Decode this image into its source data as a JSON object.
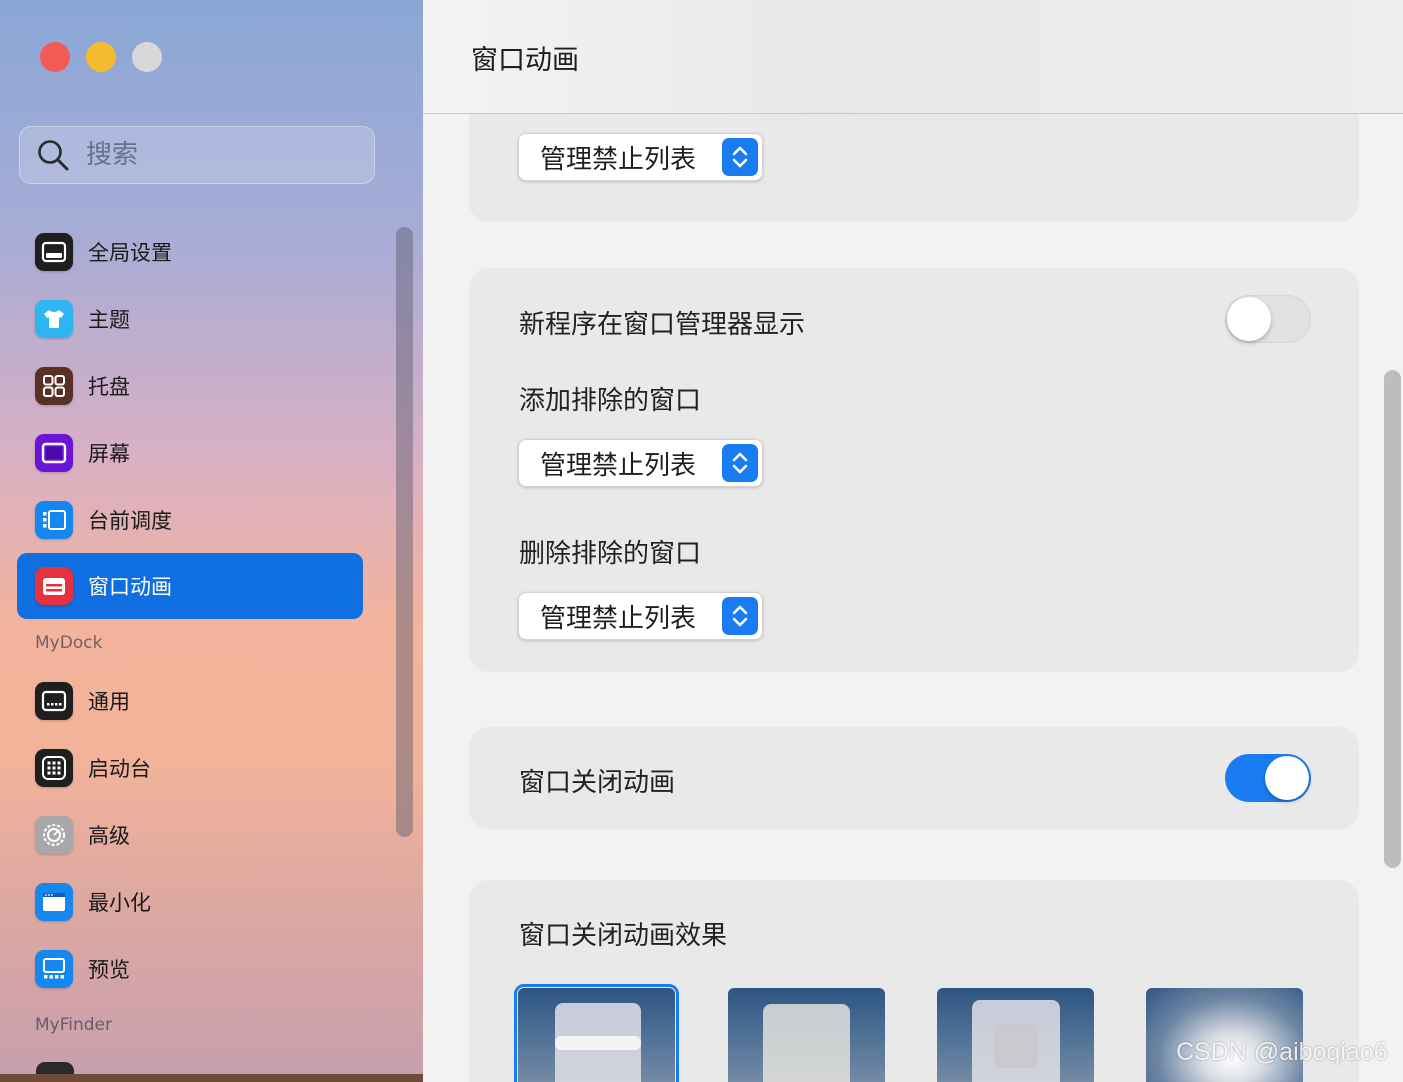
{
  "search": {
    "placeholder": "搜索"
  },
  "sidebar": {
    "items": [
      {
        "label": "全局设置",
        "icon": "window-icon"
      },
      {
        "label": "主题",
        "icon": "tshirt-icon"
      },
      {
        "label": "托盘",
        "icon": "grid-icon"
      },
      {
        "label": "屏幕",
        "icon": "screen-icon"
      },
      {
        "label": "台前调度",
        "icon": "stage-manager-icon"
      },
      {
        "label": "窗口动画",
        "icon": "window-animation-icon",
        "active": true
      }
    ],
    "mydock_header": "MyDock",
    "mydock_items": [
      {
        "label": "通用",
        "icon": "dock-icon"
      },
      {
        "label": "启动台",
        "icon": "launchpad-icon"
      },
      {
        "label": "高级",
        "icon": "gear-icon"
      },
      {
        "label": "最小化",
        "icon": "minimize-icon"
      },
      {
        "label": "预览",
        "icon": "preview-icon"
      }
    ],
    "myfinder_header": "MyFinder"
  },
  "main": {
    "title": "窗口动画",
    "popup_label": "管理禁止列表",
    "show_new_apps_label": "新程序在窗口管理器显示",
    "show_new_apps_on": false,
    "add_excluded_label": "添加排除的窗口",
    "remove_excluded_label": "删除排除的窗口",
    "close_animation_label": "窗口关闭动画",
    "close_animation_on": true,
    "close_effect_label": "窗口关闭动画效果"
  },
  "watermark": "CSDN @aiboqiao6",
  "colors": {
    "accent": "#1a7cf2",
    "sidebar_active": "#0f6fe0"
  }
}
